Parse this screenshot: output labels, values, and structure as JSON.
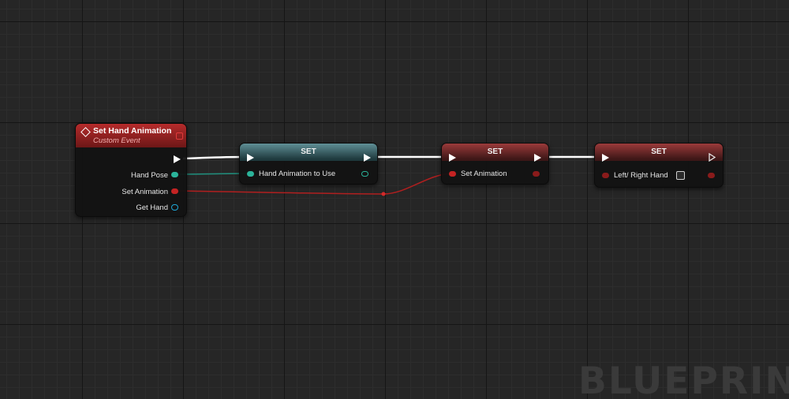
{
  "event_node": {
    "title": "Set Hand Animation",
    "subtitle": "Custom Event",
    "pins": [
      {
        "label": "Hand Pose",
        "color": "#2bb39a"
      },
      {
        "label": "Set Animation",
        "color": "#c42323"
      },
      {
        "label": "Get Hand",
        "color": "#1ea7d7"
      }
    ]
  },
  "set_nodes": [
    {
      "title": "SET",
      "input_label": "Hand Animation to Use",
      "color": "#2bb39a",
      "header": "teal"
    },
    {
      "title": "SET",
      "input_label": "Set Animation",
      "color": "#c42323",
      "header": "red"
    },
    {
      "title": "SET",
      "input_label": "Left/ Right Hand",
      "color": "#c42323",
      "header": "red"
    }
  ],
  "colors": {
    "exec_wire": "#ffffff",
    "struct_wire": "#1f8f7d",
    "bool_wire": "#b01f1f",
    "background": "#262626"
  },
  "watermark": "BLUEPRINT"
}
